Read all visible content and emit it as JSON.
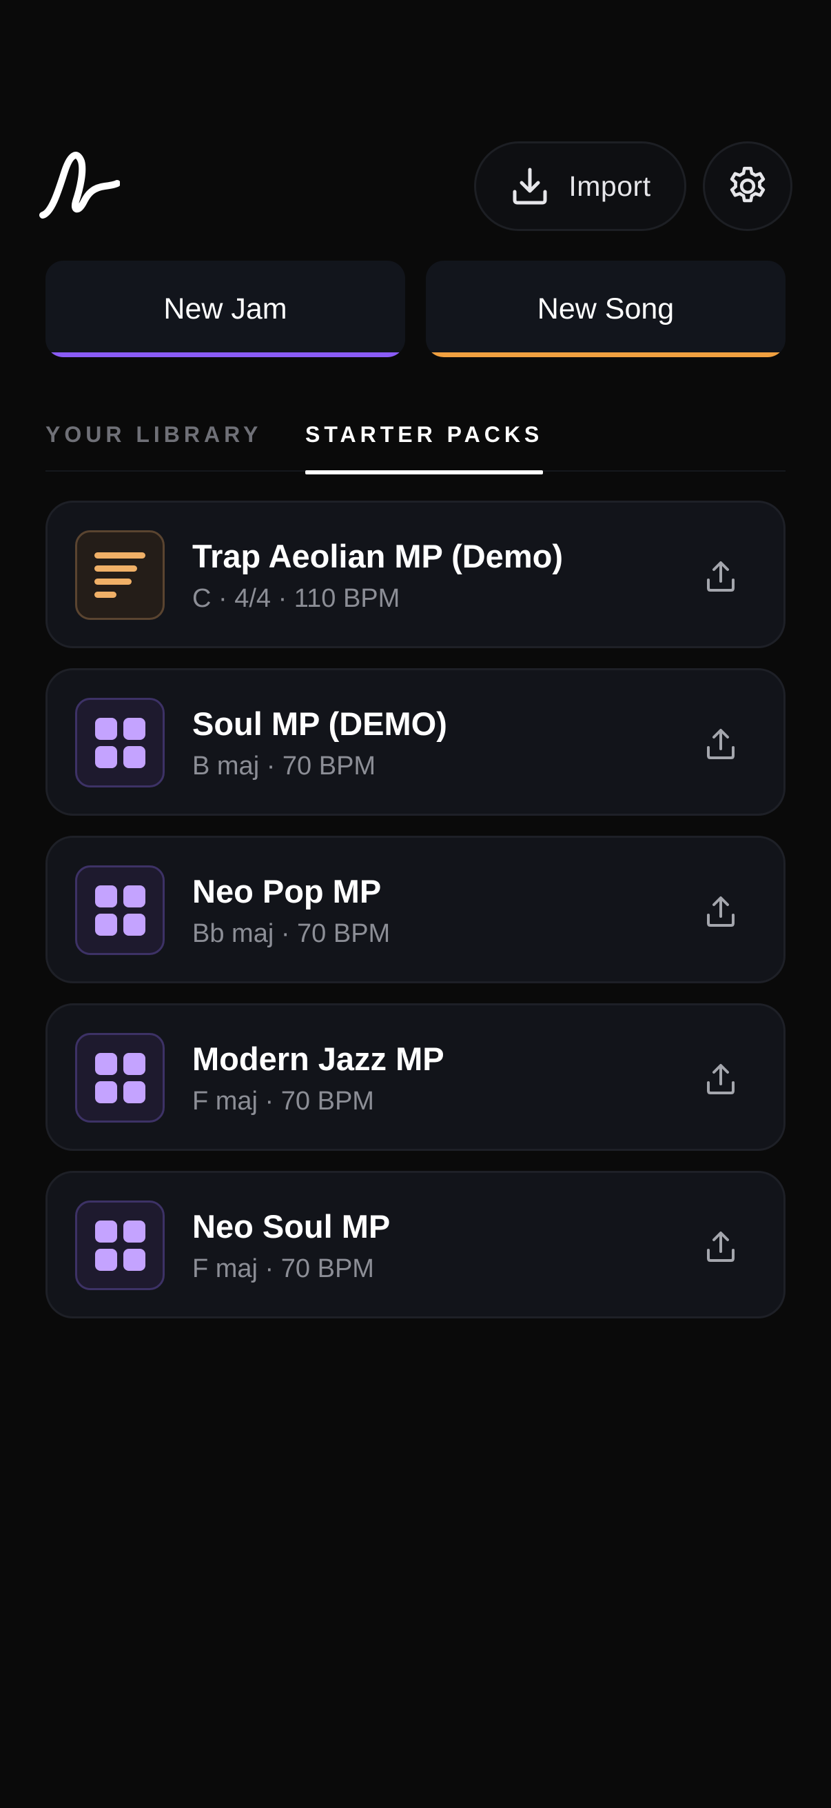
{
  "header": {
    "logo_icon": "wave-logo-icon",
    "import_label": "Import",
    "import_icon": "download-icon",
    "settings_icon": "gear-icon"
  },
  "actions": {
    "new_jam": {
      "label": "New Jam",
      "accent": "#8b5cf6"
    },
    "new_song": {
      "label": "New Song",
      "accent": "#f0a040"
    }
  },
  "tabs": [
    {
      "label": "YOUR LIBRARY",
      "active": false
    },
    {
      "label": "STARTER PACKS",
      "active": true
    }
  ],
  "packs": [
    {
      "title": "Trap Aeolian MP (Demo)",
      "meta": "C · 4/4 · 110 BPM",
      "thumb": "lines-icon",
      "thumb_color": "#f0b067"
    },
    {
      "title": "Soul MP (DEMO)",
      "meta": "B maj · 70 BPM",
      "thumb": "grid-icon",
      "thumb_color": "#c4a3ff"
    },
    {
      "title": "Neo Pop MP",
      "meta": "Bb maj · 70 BPM",
      "thumb": "grid-icon",
      "thumb_color": "#c4a3ff"
    },
    {
      "title": "Modern Jazz MP",
      "meta": "F maj · 70 BPM",
      "thumb": "grid-icon",
      "thumb_color": "#c4a3ff"
    },
    {
      "title": "Neo Soul MP",
      "meta": "F maj · 70 BPM",
      "thumb": "grid-icon",
      "thumb_color": "#c4a3ff"
    }
  ],
  "colors": {
    "background": "#0a0a0a",
    "card": "#12141a",
    "card_border": "#1e2027",
    "muted_text": "#8c8e96"
  }
}
